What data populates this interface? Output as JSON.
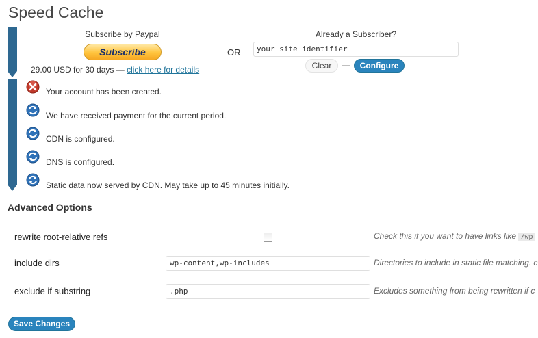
{
  "page": {
    "title": "Speed Cache"
  },
  "subscribe": {
    "heading": "Subscribe by Paypal",
    "button_label": "Subscribe",
    "price_text": "29.00 USD for 30 days —",
    "details_link": "click here for details",
    "or_label": "OR"
  },
  "subscriber": {
    "heading": "Already a Subscriber?",
    "site_identifier_value": "your site identifier",
    "clear_label": "Clear",
    "separator": "—",
    "configure_label": "Configure"
  },
  "status_items": [
    {
      "icon": "error-icon",
      "text": "Your account has been created."
    },
    {
      "icon": "refresh-icon",
      "text": "We have received payment for the current period."
    },
    {
      "icon": "refresh-icon",
      "text": "CDN is configured."
    },
    {
      "icon": "refresh-icon",
      "text": "DNS is configured."
    },
    {
      "icon": "refresh-icon",
      "text": "Static data now served by CDN. May take up to 45 minutes initially."
    }
  ],
  "advanced": {
    "title": "Advanced Options",
    "options": [
      {
        "label": "rewrite root-relative refs",
        "checked": false,
        "description": "Check this if you want to have links like",
        "code": "/wp"
      },
      {
        "label": "include dirs",
        "value": "wp-content,wp-includes",
        "description": "Directories to include in static file matching. c"
      },
      {
        "label": "exclude if substring",
        "value": ".php",
        "description": "Excludes something from being rewritten if c"
      }
    ],
    "save_label": "Save Changes"
  },
  "colors": {
    "accent": "#2a84bd",
    "bar": "#2e6891",
    "error": "#c0392b",
    "refresh": "#2f72b8"
  }
}
